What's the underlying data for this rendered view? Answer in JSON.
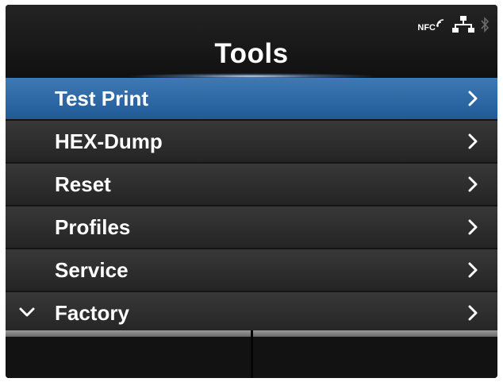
{
  "header": {
    "title": "Tools",
    "status": {
      "nfc_label": "NFC",
      "icons": [
        "nfc-icon",
        "network-icon",
        "bluetooth-icon"
      ]
    }
  },
  "menu": {
    "selected_index": 0,
    "items": [
      {
        "label": "Test Print"
      },
      {
        "label": "HEX-Dump"
      },
      {
        "label": "Reset"
      },
      {
        "label": "Profiles"
      },
      {
        "label": "Service"
      },
      {
        "label": "Factory"
      }
    ]
  },
  "footer": {
    "left_label": "",
    "right_label": ""
  },
  "colors": {
    "selected": "#2a68a8",
    "item_bg": "#2e2e2e",
    "screen_bg": "#151515",
    "text": "#ffffff"
  }
}
